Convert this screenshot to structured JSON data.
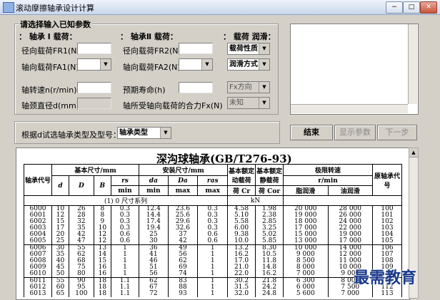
{
  "window": {
    "title": "滚动摩擦轴承设计计算",
    "buttons": [
      "−",
      "□",
      "✕"
    ]
  },
  "input_group": {
    "title": "请选择输入已知参数",
    "load1": {
      "header": "： 轴承 Ⅰ 载荷：",
      "radial_label": "径向载荷FR1(N)",
      "axial_label": "轴向载荷FA1(N)"
    },
    "load2": {
      "header": "： 轴承Ⅱ 载荷：",
      "radial_label": "径向载荷FR2(N)",
      "axial_label": "轴向载荷FA2(N)"
    },
    "right": {
      "header": "： 载荷  润滑：",
      "load_nature": "载荷性质",
      "lubrication": "润滑方式"
    },
    "speed_label": "轴转速n(r/min)",
    "diameter_label": "轴颈直径d(mm)",
    "life_label": "预期寿命(h)",
    "resultant_label": "轴所受轴向载荷的合力Fx(N)",
    "fx_direction": "Fx方向",
    "unknown": "未知"
  },
  "bearing_select": {
    "label": "根据d试选轴承类型及型号：",
    "value": "轴承类型"
  },
  "buttons": {
    "finish": "结束",
    "show_params": "显示参数",
    "next": "下一步"
  },
  "table": {
    "title": "深沟球轴承(GB/T276-93)",
    "headers": {
      "code": "轴承代号",
      "basic_size": "基本尺寸/mm",
      "install_size": "安装尺寸/mm",
      "dynamic": "基本额定动载荷",
      "static": "基本额定静载荷",
      "limit_speed": "极限转速",
      "orig_code": "原轴承代号",
      "d": "d",
      "D": "D",
      "B": "B",
      "rs": "rs",
      "rs_sub": "min",
      "da": "da",
      "da_sub": "min",
      "Da": "Da",
      "Da_sub": "max",
      "ras": "ras",
      "ras_sub": "max",
      "cr": "荷 Cr",
      "cor": "荷 Cor",
      "kn": "kN",
      "rpm": "r/min",
      "grease": "脂润滑",
      "oil": "油润滑",
      "series": "(1) 0 尺寸系列"
    },
    "rows": [
      [
        "6000",
        "10",
        "26",
        "8",
        "0.3",
        "12.4",
        "23.6",
        "0.3",
        "4.58",
        "1.98",
        "20 000",
        "28 000",
        "100"
      ],
      [
        "6001",
        "12",
        "28",
        "8",
        "0.3",
        "14.4",
        "25.6",
        "0.3",
        "5.10",
        "2.38",
        "19 000",
        "26 000",
        "101"
      ],
      [
        "6002",
        "15",
        "32",
        "9",
        "0.3",
        "17.4",
        "29.6",
        "0.3",
        "5.58",
        "2.85",
        "18 000",
        "24 000",
        "102"
      ],
      [
        "6003",
        "17",
        "35",
        "10",
        "0.3",
        "19.4",
        "32.6",
        "0.3",
        "6.00",
        "3.25",
        "17 000",
        "22 000",
        "103"
      ],
      [
        "6004",
        "20",
        "42",
        "12",
        "0.6",
        "25",
        "37",
        "0.6",
        "9.38",
        "5.02",
        "15 000",
        "19 000",
        "104"
      ],
      [
        "6005",
        "25",
        "47",
        "12",
        "0.6",
        "30",
        "42",
        "0.6",
        "10.0",
        "5.85",
        "13 000",
        "17 000",
        "105"
      ],
      [
        "6006",
        "30",
        "55",
        "13",
        "1",
        "36",
        "49",
        "1",
        "13.2",
        "8.30",
        "10 000",
        "14 000",
        "106"
      ],
      [
        "6007",
        "35",
        "62",
        "14",
        "1",
        "41",
        "56",
        "1",
        "16.2",
        "10.5",
        "9 000",
        "12 000",
        "107"
      ],
      [
        "6008",
        "40",
        "68",
        "15",
        "1",
        "46",
        "62",
        "1",
        "17.0",
        "11.8",
        "8 500",
        "11 000",
        "108"
      ],
      [
        "6009",
        "45",
        "75",
        "16",
        "1",
        "51",
        "69",
        "1",
        "21.0",
        "14.8",
        "8 000",
        "10 000",
        "109"
      ],
      [
        "6010",
        "50",
        "80",
        "16",
        "1",
        "56",
        "74",
        "1",
        "22.0",
        "16.2",
        "7 000",
        "9 000",
        "110"
      ],
      [
        "6011",
        "55",
        "90",
        "18",
        "1.1",
        "62",
        "83",
        "1",
        "30.2",
        "21.8",
        "6 300",
        "8 000",
        "111"
      ],
      [
        "6012",
        "60",
        "95",
        "18",
        "1.1",
        "67",
        "88",
        "1",
        "31.5",
        "24.2",
        "6 000",
        "7 500",
        "112"
      ],
      [
        "6013",
        "65",
        "100",
        "18",
        "1.1",
        "72",
        "93",
        "1",
        "32.0",
        "24.8",
        "5 600",
        "7 000",
        "113"
      ]
    ]
  },
  "watermark": "最需教育"
}
